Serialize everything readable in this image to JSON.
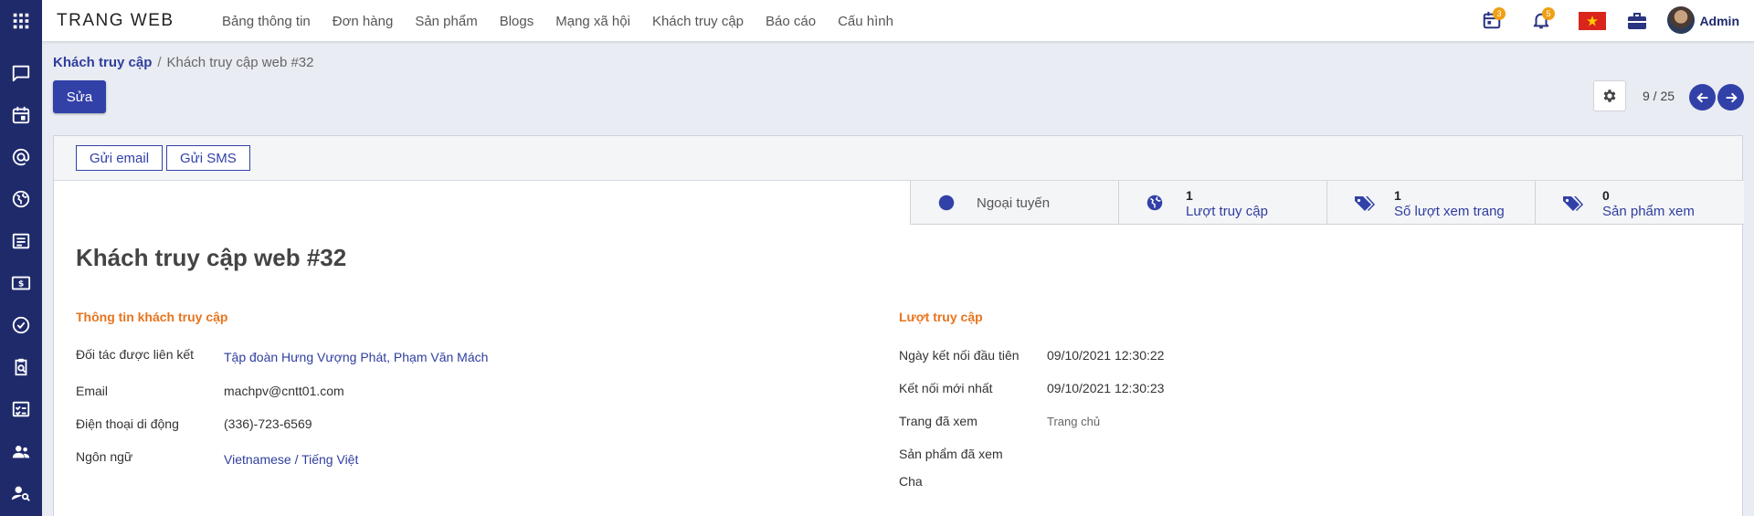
{
  "app": {
    "brand": "TRANG WEB"
  },
  "menu": [
    "Bảng thông tin",
    "Đơn hàng",
    "Sản phẩm",
    "Blogs",
    "Mạng xã hội",
    "Khách truy cập",
    "Báo cáo",
    "Cấu hình"
  ],
  "topbar": {
    "calendar_badge": "3",
    "bell_badge": "5",
    "user_name": "Admin"
  },
  "breadcrumb": {
    "parent": "Khách truy cập",
    "separator": "/",
    "current": "Khách truy cập web #32"
  },
  "control": {
    "edit_label": "Sửa",
    "pager": "9 / 25"
  },
  "statusbar": {
    "send_email": "Gửi email",
    "send_sms": "Gửi SMS"
  },
  "smart_buttons": {
    "status": "Ngoại tuyến",
    "visits": {
      "count": "1",
      "label": "Lượt truy cập"
    },
    "page_views": {
      "count": "1",
      "label": "Số lượt xem trang"
    },
    "products": {
      "count": "0",
      "label": "Sản phẩm xem"
    }
  },
  "record": {
    "title": "Khách truy cập web #32",
    "left_group": {
      "title": "Thông tin khách truy cập",
      "fields": [
        {
          "label": "Đối tác được liên kết",
          "value": "Tập đoàn Hưng Vượng Phát, Phạm Văn Mách"
        },
        {
          "label": "Email",
          "value": "machpv@cntt01.com"
        },
        {
          "label": "Điện thoại di động",
          "value": "(336)-723-6569"
        },
        {
          "label": "Ngôn ngữ",
          "value": "Vietnamese / Tiếng Việt"
        }
      ]
    },
    "right_group": {
      "title": "Lượt truy cập",
      "fields": [
        {
          "label": "Ngày kết nối đầu tiên",
          "value": "09/10/2021 12:30:22"
        },
        {
          "label": "Kết nối mới nhất",
          "value": "09/10/2021 12:30:23"
        },
        {
          "label": "Trang đã xem",
          "value": "Trang chủ"
        },
        {
          "label": "Sản phẩm đã xem",
          "value": ""
        },
        {
          "label": "Cha",
          "value": ""
        }
      ]
    }
  },
  "colors": {
    "rail": "#1f2a6b",
    "primary": "#3241a8",
    "group_title": "#e8741e",
    "badge": "#f0a013"
  }
}
